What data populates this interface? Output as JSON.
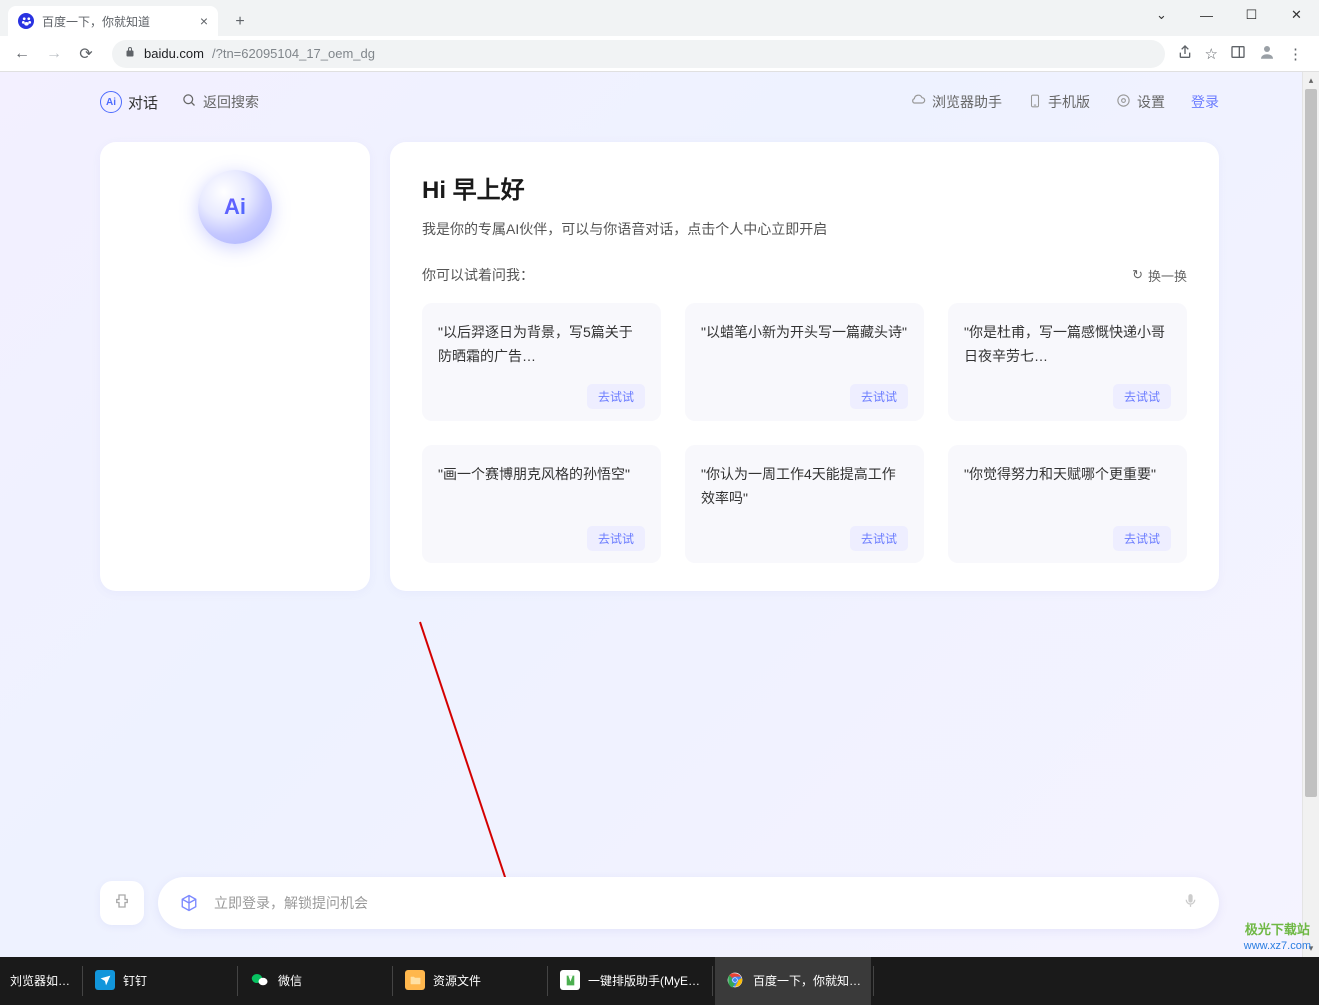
{
  "browser": {
    "tab_title": "百度一下，你就知道",
    "url_domain": "baidu.com",
    "url_path": "/?tn=62095104_17_oem_dg"
  },
  "header": {
    "chat_label": "对话",
    "back_search": "返回搜索",
    "links": {
      "browser_helper": "浏览器助手",
      "mobile": "手机版",
      "settings": "设置",
      "login": "登录"
    }
  },
  "sidebar": {
    "ai_badge": "Ai"
  },
  "main": {
    "greeting": "Hi 早上好",
    "greeting_sub": "我是你的专属AI伙伴，可以与你语音对话，点击个人中心立即开启",
    "prompt_label": "你可以试着问我：",
    "refresh_label": "换一换",
    "try_label": "去试试",
    "cards": [
      "\"以后羿逐日为背景，写5篇关于防晒霜的广告…",
      "\"以蜡笔小新为开头写一篇藏头诗\"",
      "\"你是杜甫，写一篇感慨快递小哥日夜辛劳七…",
      "\"画一个赛博朋克风格的孙悟空\"",
      "\"你认为一周工作4天能提高工作效率吗\"",
      "\"你觉得努力和天赋哪个更重要\""
    ]
  },
  "input": {
    "placeholder": "立即登录，解锁提问机会"
  },
  "taskbar": {
    "items": [
      "刘览器如…",
      "钉钉",
      "微信",
      "资源文件",
      "一键排版助手(MyE…",
      "百度一下，你就知…"
    ]
  },
  "watermark": {
    "line1": "极光下载站",
    "line2": "www.xz7.com"
  }
}
